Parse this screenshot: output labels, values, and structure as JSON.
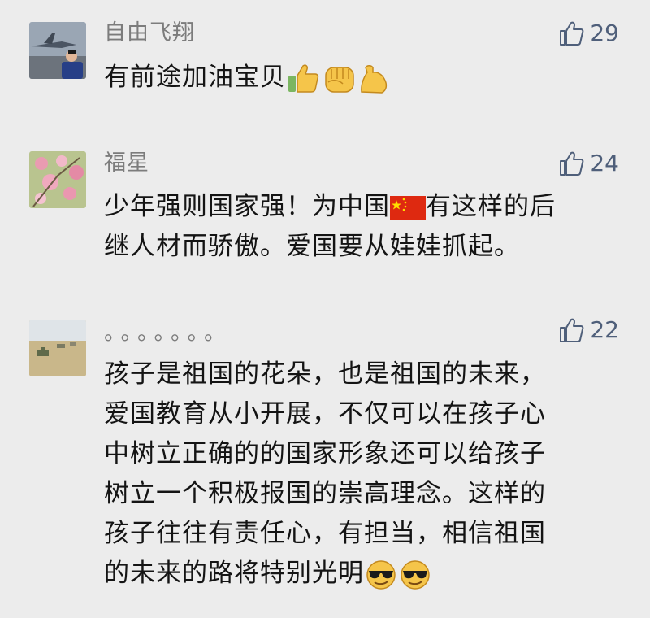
{
  "comments": [
    {
      "username": "自由飞翔",
      "likes": "29",
      "lines": [
        "有前途加油宝贝"
      ],
      "emojis": [
        "thumbs-up-icon",
        "fist-icon",
        "flexed-biceps-icon"
      ]
    },
    {
      "username": "福星",
      "likes": "24",
      "lines": [
        "少年强则国家强！为中国",
        "有这样的后",
        "继人材而骄傲。爱国要从娃娃抓起。"
      ],
      "emojis": [
        "china-flag-icon"
      ]
    },
    {
      "username": "。。。。。。。",
      "likes": "22",
      "lines": [
        "孩子是祖国的花朵，也是祖国的未来，",
        "爱国教育从小开展，不仅可以在孩子心",
        "中树立正确的的国家形象还可以给孩子",
        "树立一个积极报国的崇高理念。这样的",
        "孩子往往有责任心，有担当，相信祖国",
        "的未来的路将特别光明"
      ],
      "emojis": [
        "sunglasses-face-icon",
        "sunglasses-face-icon"
      ]
    }
  ],
  "colors": {
    "background": "#ececec",
    "username": "#7c7c7c",
    "likes": "#4f5f7a",
    "text": "#141414"
  }
}
